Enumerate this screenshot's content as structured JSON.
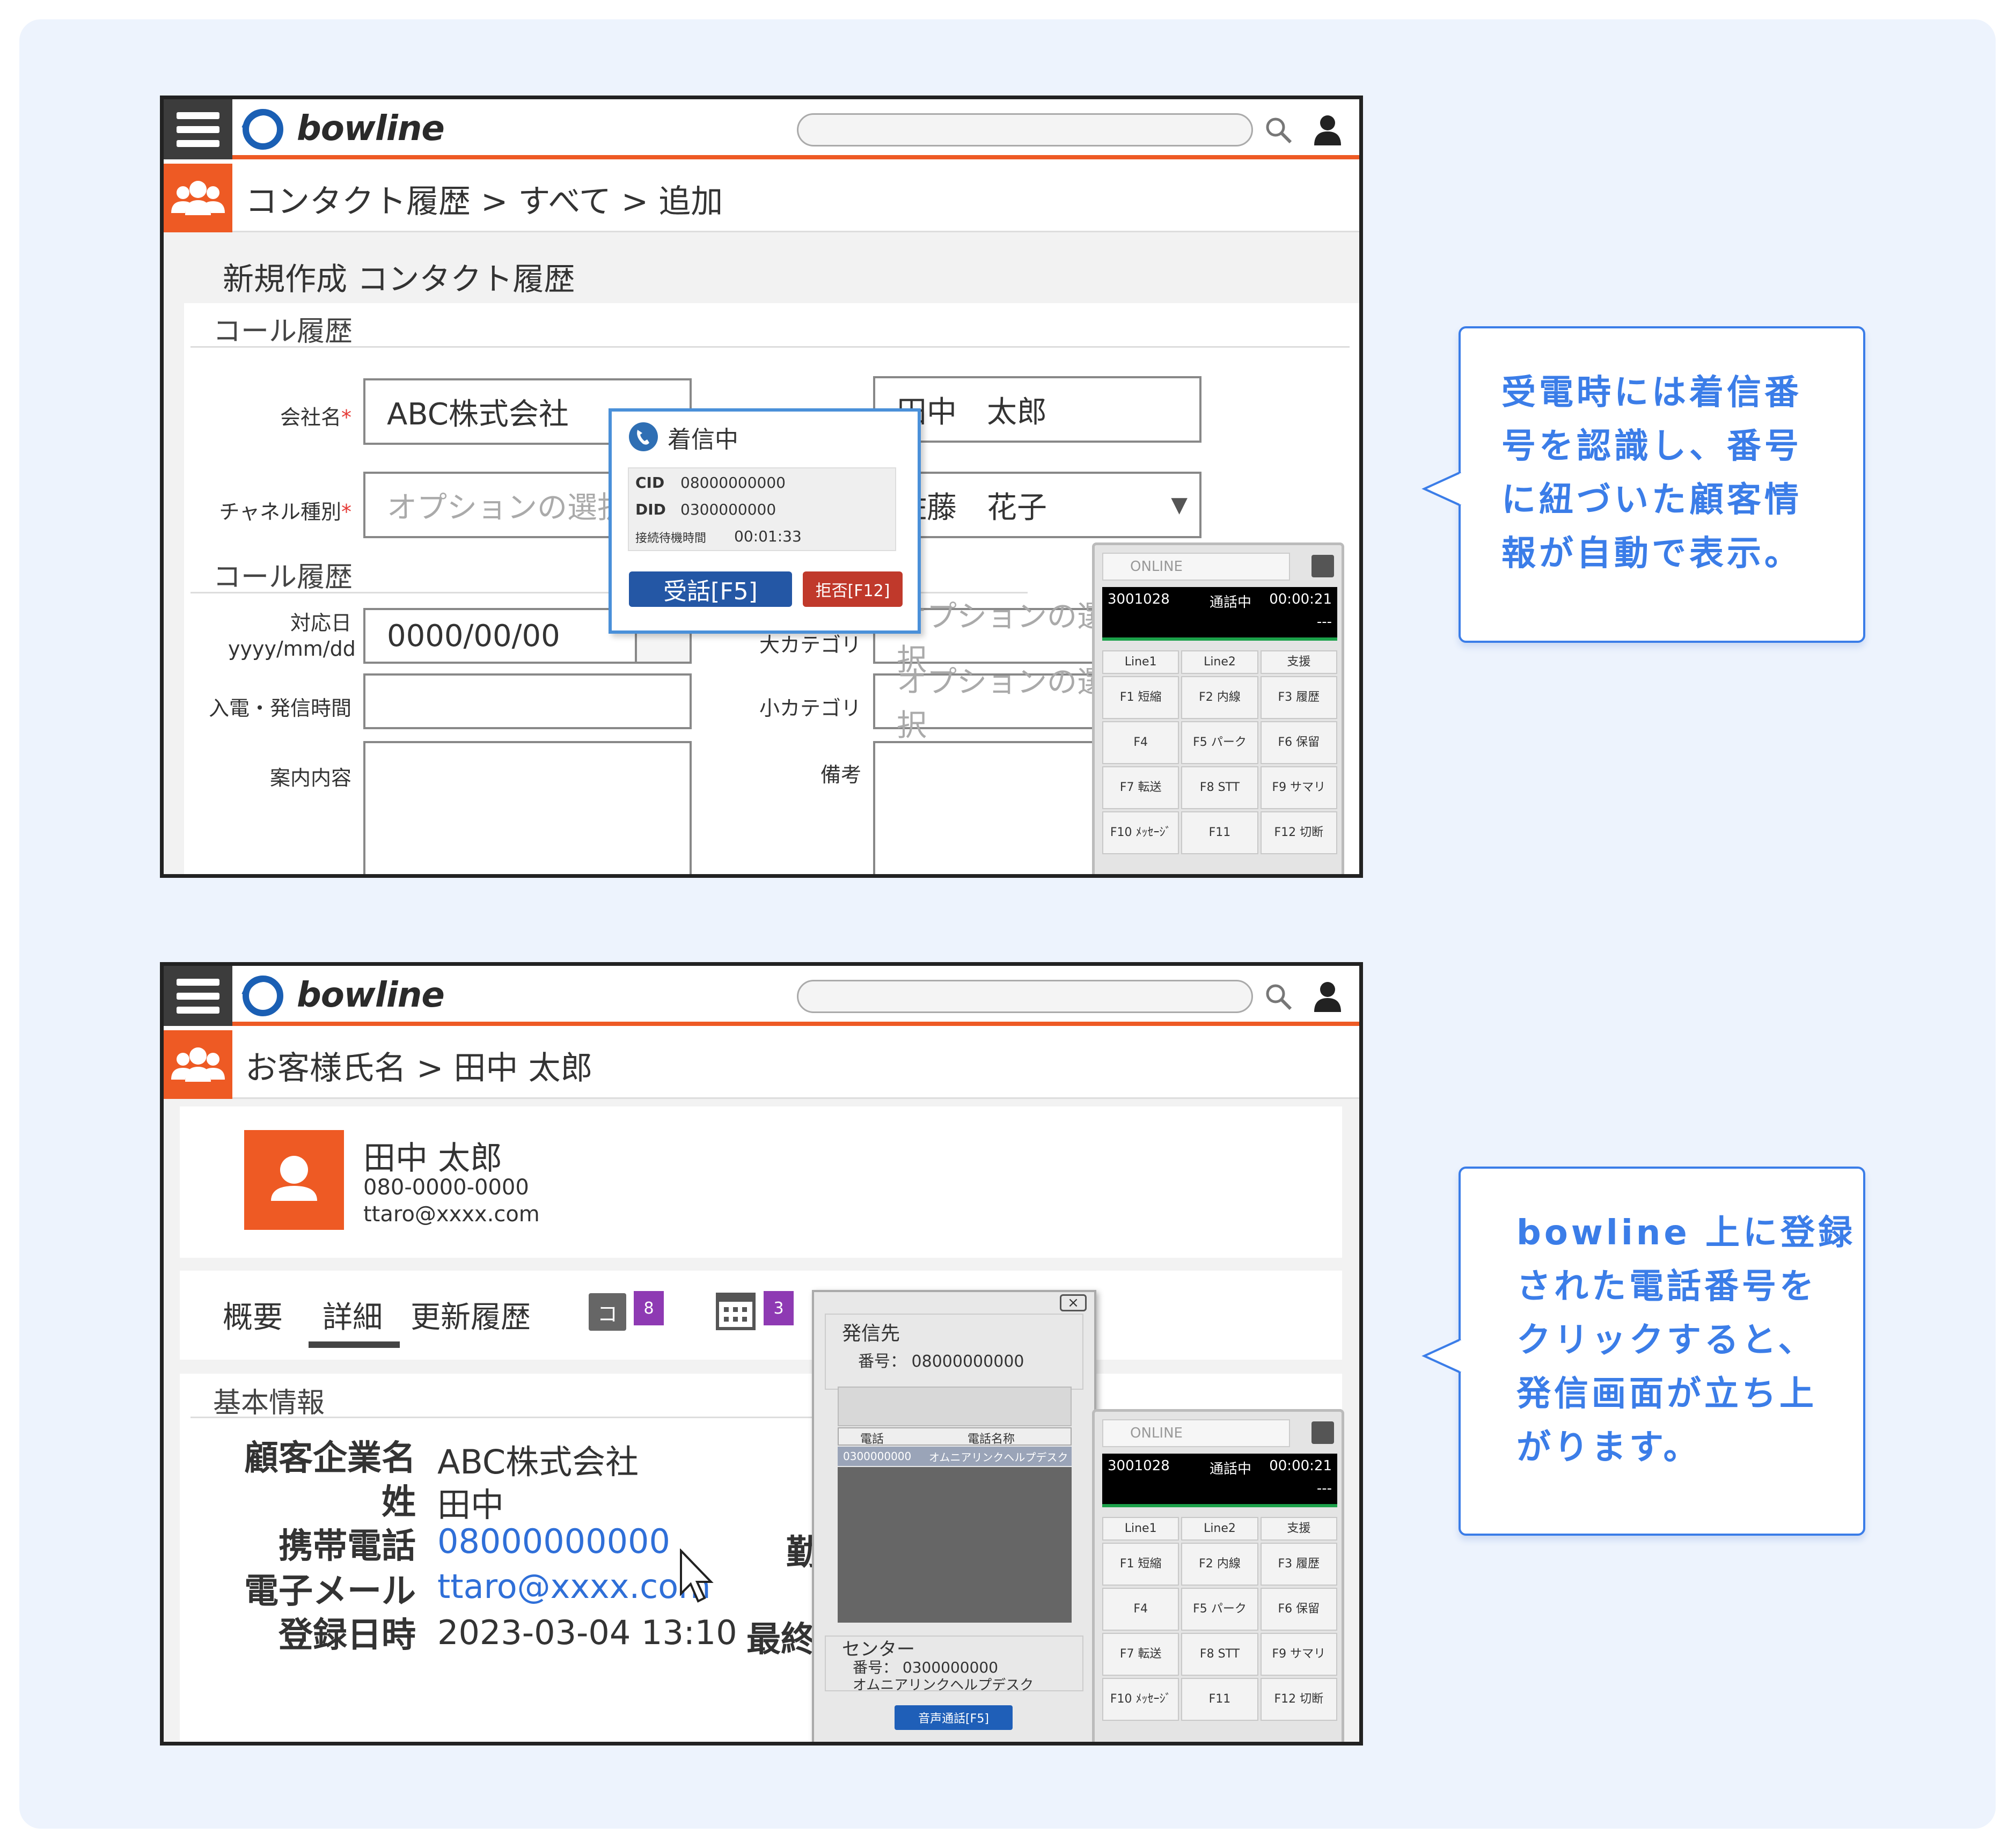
{
  "app": {
    "logo": "bowline"
  },
  "screen1": {
    "breadcrumb": "コンタクト履歴 > すべて > 追加",
    "page_title": "新規作成 コンタクト履歴",
    "section1": "コール履歴",
    "section2": "コール履歴",
    "fields": {
      "company_label": "会社名",
      "company_value": "ABC株式会社",
      "person_value": "田中　太郎",
      "channel_label": "チャネル種別",
      "channel_placeholder": "オプションの選択",
      "owner_value": "佐藤　花子",
      "date_label_1": "対応日",
      "date_label_2": "yyyy/mm/dd",
      "date_value": "0000/00/00",
      "bigcat_label": "大カテゴリ",
      "bigcat_placeholder": "オプションの選択",
      "time_label": "入電・発信時間",
      "smallcat_label": "小カテゴリ",
      "smallcat_placeholder": "オプションの選択",
      "content_label": "案内内容",
      "note_label": "備考",
      "required_mark": "*"
    },
    "incoming": {
      "title": "着信中",
      "cid_label": "CID",
      "cid_value": "08000000000",
      "did_label": "DID",
      "did_value": "0300000000",
      "wait_label": "接続待機時間",
      "wait_value": "00:01:33",
      "answer_button": "受話[F5]",
      "reject_button": "拒否[F12]"
    }
  },
  "softphone": {
    "status": "ONLINE",
    "ext": "3001028",
    "state": "通話中",
    "timer": "00:00:21",
    "dash": "---",
    "lines": [
      "Line1",
      "Line2",
      "支援"
    ],
    "keys": [
      {
        "k": "F1",
        "l": "短縮"
      },
      {
        "k": "F2",
        "l": "内線"
      },
      {
        "k": "F3",
        "l": "履歴"
      },
      {
        "k": "F4",
        "l": ""
      },
      {
        "k": "F5",
        "l": "パーク"
      },
      {
        "k": "F6",
        "l": "保留"
      },
      {
        "k": "F7",
        "l": "転送"
      },
      {
        "k": "F8",
        "l": "STT"
      },
      {
        "k": "F9",
        "l": "サマリ"
      },
      {
        "k": "F10",
        "l": "ﾒｯｾｰｼﾞ"
      },
      {
        "k": "F11",
        "l": ""
      },
      {
        "k": "F12",
        "l": "切断"
      }
    ]
  },
  "screen2": {
    "breadcrumb": "お客様氏名 > 田中 太郎",
    "contact_name": "田中 太郎",
    "contact_phone": "080-0000-0000",
    "contact_email": "ttaro@xxxx.com",
    "tabs": [
      "概要",
      "詳細",
      "更新履歴"
    ],
    "badge1_icon": "コ",
    "badge1_count": "8",
    "badge2_count": "3",
    "section": "基本情報",
    "info": [
      {
        "label": "顧客企業名",
        "value": "ABC株式会社"
      },
      {
        "label": "姓",
        "value": "田中"
      },
      {
        "label": "携帯電話",
        "value": "08000000000"
      },
      {
        "label": "電子メール",
        "value": "ttaro@xxxx.com"
      },
      {
        "label": "登録日時",
        "value": "2023-03-04 13:10"
      }
    ],
    "cut_label_1": "勤",
    "cut_label_2": "最終",
    "dialer": {
      "close": "×",
      "dest_title": "発信先",
      "dest_number": "番号：  08000000000",
      "col_phone": "電話",
      "col_name": "電話名称",
      "row_phone": "0300000000",
      "row_name": "オムニアリンクヘルプデスク",
      "center_title": "センター",
      "center_number": "番号：  0300000000",
      "center_name": "オムニアリンクヘルプデスク",
      "call_button": "音声通話[F5]"
    }
  },
  "callouts": {
    "c1": [
      "受電時には着信番",
      "号を認識し、番号",
      "に紐づいた顧客情",
      "報が自動で表示。"
    ],
    "c2": [
      "bowline 上に登録",
      "された電話番号を",
      "クリックすると、",
      "発信画面が立ち上",
      "がります。"
    ]
  },
  "colors": {
    "accent": "#ee5a24",
    "callout": "#3b7de8",
    "badge": "#8e3ab3",
    "link": "#2f6fd8"
  }
}
